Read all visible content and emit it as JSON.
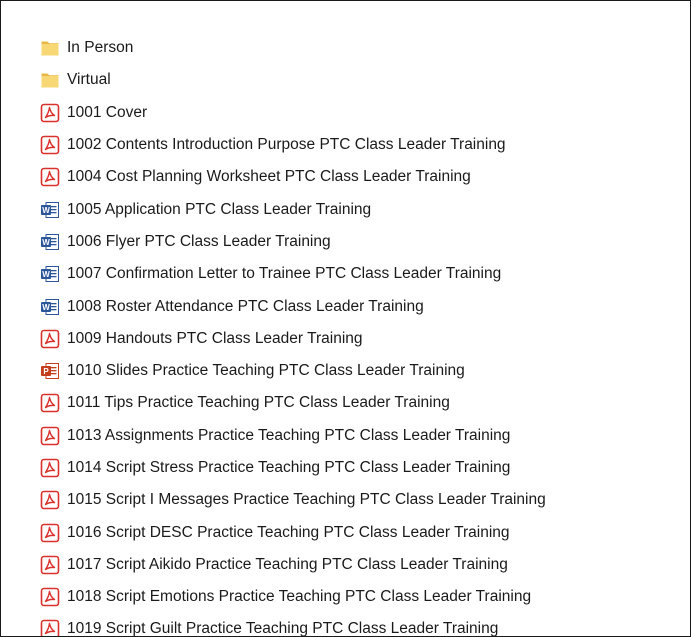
{
  "files": [
    {
      "name": "In Person",
      "icon": "folder-icon"
    },
    {
      "name": "Virtual",
      "icon": "folder-icon"
    },
    {
      "name": "1001 Cover",
      "icon": "pdf-icon"
    },
    {
      "name": "1002 Contents Introduction Purpose PTC Class Leader Training",
      "icon": "pdf-icon"
    },
    {
      "name": "1004 Cost Planning Worksheet PTC Class Leader Training",
      "icon": "pdf-icon"
    },
    {
      "name": "1005 Application PTC Class Leader Training",
      "icon": "word-icon"
    },
    {
      "name": "1006 Flyer PTC Class Leader Training",
      "icon": "word-icon"
    },
    {
      "name": "1007 Confirmation Letter to Trainee PTC Class Leader Training",
      "icon": "word-icon"
    },
    {
      "name": "1008 Roster Attendance PTC Class Leader Training",
      "icon": "word-icon"
    },
    {
      "name": "1009 Handouts PTC Class Leader Training",
      "icon": "pdf-icon"
    },
    {
      "name": "1010 Slides Practice Teaching PTC Class Leader Training",
      "icon": "powerpoint-icon"
    },
    {
      "name": "1011 Tips Practice Teaching PTC Class Leader Training",
      "icon": "pdf-icon"
    },
    {
      "name": "1013 Assignments Practice Teaching PTC Class Leader Training",
      "icon": "pdf-icon"
    },
    {
      "name": "1014 Script Stress Practice Teaching PTC Class Leader Training",
      "icon": "pdf-icon"
    },
    {
      "name": "1015 Script I Messages Practice Teaching PTC Class Leader Training",
      "icon": "pdf-icon"
    },
    {
      "name": "1016 Script DESC Practice Teaching PTC Class Leader Training",
      "icon": "pdf-icon"
    },
    {
      "name": "1017 Script Aikido Practice Teaching PTC Class Leader Training",
      "icon": "pdf-icon"
    },
    {
      "name": "1018 Script Emotions Practice Teaching PTC Class Leader Training",
      "icon": "pdf-icon"
    },
    {
      "name": "1019 Script Guilt Practice Teaching PTC Class Leader Training",
      "icon": "pdf-icon"
    }
  ],
  "colors": {
    "folder": "#f8d775",
    "pdf": "#d9312b",
    "word": "#2b579a",
    "powerpoint": "#c43e1c",
    "text": "#1a1a1a"
  }
}
